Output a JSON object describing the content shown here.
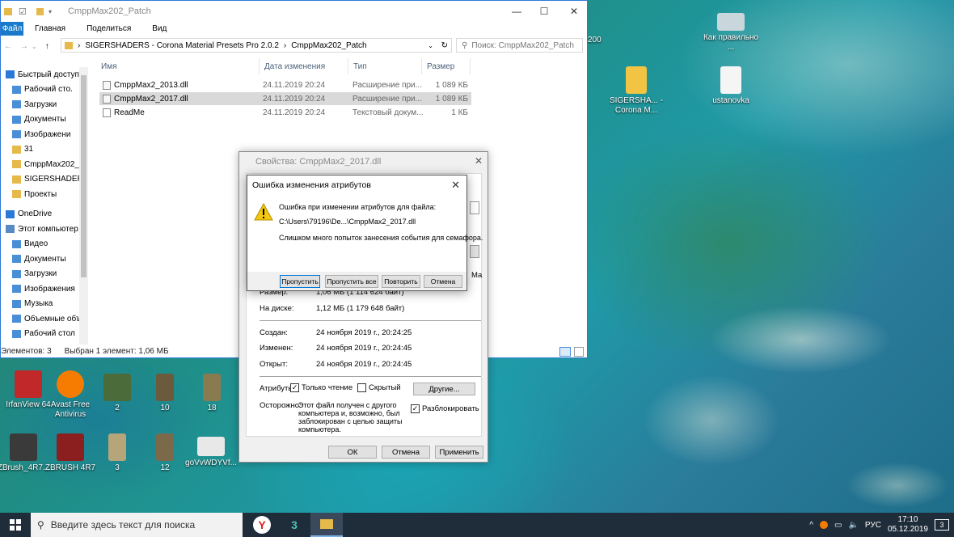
{
  "explorer": {
    "title": "CmppMax202_Patch",
    "ribbon": {
      "file": "Файл",
      "tabs": [
        "Главная",
        "Поделиться",
        "Вид"
      ]
    },
    "address": {
      "path": [
        "SIGERSHADERS - Corona Material Presets Pro 2.0.2",
        "CmppMax202_Patch"
      ]
    },
    "search_placeholder": "Поиск: CmppMax202_Patch",
    "nav": [
      {
        "label": "Быстрый доступ",
        "icon": "star-icon"
      },
      {
        "label": "Рабочий сто.",
        "icon": "desktop-folder-icon"
      },
      {
        "label": "Загрузки",
        "icon": "downloads-folder-icon"
      },
      {
        "label": "Документы",
        "icon": "documents-folder-icon"
      },
      {
        "label": "Изображени",
        "icon": "pictures-folder-icon"
      },
      {
        "label": "31",
        "icon": "folder-icon"
      },
      {
        "label": "CmppMax202_Pa",
        "icon": "folder-icon"
      },
      {
        "label": "SIGERSHADERS",
        "icon": "folder-icon"
      },
      {
        "label": "Проекты",
        "icon": "folder-icon"
      },
      {
        "label": "OneDrive",
        "icon": "cloud-icon"
      },
      {
        "label": "Этот компьютер",
        "icon": "computer-icon"
      },
      {
        "label": "Видео",
        "icon": "video-folder-icon"
      },
      {
        "label": "Документы",
        "icon": "documents-folder-icon"
      },
      {
        "label": "Загрузки",
        "icon": "downloads-folder-icon"
      },
      {
        "label": "Изображения",
        "icon": "pictures-folder-icon"
      },
      {
        "label": "Музыка",
        "icon": "music-folder-icon"
      },
      {
        "label": "Объемные объ",
        "icon": "3d-objects-folder-icon"
      },
      {
        "label": "Рабочий стол",
        "icon": "desktop-folder-icon"
      }
    ],
    "columns": [
      "Имя",
      "Дата изменения",
      "Тип",
      "Размер"
    ],
    "files": [
      {
        "name": "CmppMax2_2013.dll",
        "date": "24.11.2019 20:24",
        "type": "Расширение при...",
        "size": "1 089 КБ"
      },
      {
        "name": "CmppMax2_2017.dll",
        "date": "24.11.2019 20:24",
        "type": "Расширение при...",
        "size": "1 089 КБ"
      },
      {
        "name": "ReadMe",
        "date": "24.11.2019 20:24",
        "type": "Текстовый докум...",
        "size": "1 КБ"
      }
    ],
    "status": {
      "count": "Элементов: 3",
      "selected": "Выбран 1 элемент: 1,06 МБ"
    }
  },
  "properties": {
    "title": "Свойства: CmppMax2_2017.dll",
    "clipped_edge": "Ма",
    "rows": [
      {
        "label": "Размер:",
        "value": "1,06 МБ (1 114 624 байт)"
      },
      {
        "label": "На диске:",
        "value": "1,12 МБ (1 179 648 байт)"
      },
      {
        "label": "Создан:",
        "value": "24 ноября 2019 г., 20:24:25"
      },
      {
        "label": "Изменен:",
        "value": "24 ноября 2019 г., 20:24:45"
      },
      {
        "label": "Открыт:",
        "value": "24 ноября 2019 г., 20:24:45"
      }
    ],
    "attributes_label": "Атрибуты:",
    "readonly_label": "Только чтение",
    "hidden_label": "Скрытый",
    "other_button": "Другие...",
    "security_label": "Осторожно:",
    "security_text": [
      "Этот файл получен с другого",
      "компьютера и, возможно, был",
      "заблокирован с целью защиты",
      "компьютера."
    ],
    "unblock_label": "Разблокировать",
    "buttons": {
      "ok": "ОК",
      "cancel": "Отмена",
      "apply": "Применить"
    }
  },
  "error_dialog": {
    "title": "Ошибка изменения атрибутов",
    "line1": "Ошибка при изменении атрибутов для файла:",
    "path": "C:\\Users\\79196\\De...\\CmppMax2_2017.dll",
    "line2": "Слишком много попыток занесения события для семафора.",
    "buttons": {
      "skip": "Пропустить",
      "skip_all": "Пропустить все",
      "retry": "Повторить",
      "cancel": "Отмена"
    }
  },
  "desktop_icons": [
    {
      "label": "IrfanView 64",
      "color": "#c0282a"
    },
    {
      "label": "Avast Free Antivirus",
      "color": "#f57c00"
    },
    {
      "label": "2",
      "color": "#4b6b3a"
    },
    {
      "label": "10",
      "color": "#6c5a3c"
    },
    {
      "label": "18",
      "color": "#8a7a50"
    },
    {
      "label": "ZBrush_4R7...",
      "color": "#3a3a3a"
    },
    {
      "label": "ZBRUSH 4R7",
      "color": "#8b1f1f"
    },
    {
      "label": "3",
      "color": "#b7a57a"
    },
    {
      "label": "12",
      "color": "#7a6a4a"
    },
    {
      "label": "goVvWDYVf...",
      "color": "#e8e8e8"
    },
    {
      "label": "Как правильно ...",
      "color": "#c9d6dc"
    },
    {
      "label": "SIGERSHA... - Corona M...",
      "color": "#f1c443"
    },
    {
      "label": "ustanovka",
      "color": "#f5f5f5"
    },
    {
      "label": "200",
      "color": "#cfe0e6"
    }
  ],
  "taskbar": {
    "search_placeholder": "Введите здесь текст для поиска",
    "lang": "РУС",
    "time": "17:10",
    "date": "05.12.2019",
    "notifications": "3"
  }
}
